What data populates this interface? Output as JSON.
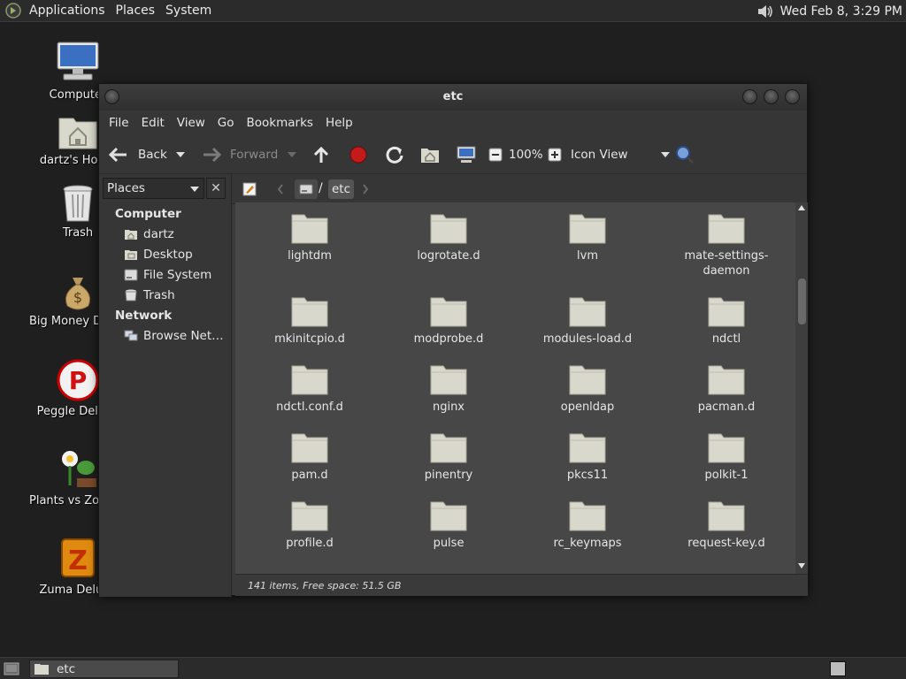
{
  "top_panel": {
    "menus": [
      "Applications",
      "Places",
      "System"
    ],
    "clock": "Wed Feb  8,  3:29 PM"
  },
  "desktop": {
    "icons": [
      {
        "label": "Computer",
        "icon": "computer-icon"
      },
      {
        "label": "dartz's Home",
        "icon": "home-folder-icon"
      },
      {
        "label": "Trash",
        "icon": "trash-icon"
      },
      {
        "label": "Big Money Deluxe",
        "icon": "money-bag-icon"
      },
      {
        "label": "Peggle Deluxe",
        "icon": "peggle-icon"
      },
      {
        "label": "Plants vs Zombies",
        "icon": "plants-icon"
      },
      {
        "label": "Zuma Deluxe",
        "icon": "zuma-icon"
      }
    ]
  },
  "window": {
    "title": "etc",
    "menu": [
      "File",
      "Edit",
      "View",
      "Go",
      "Bookmarks",
      "Help"
    ],
    "toolbar": {
      "back": "Back",
      "forward": "Forward",
      "zoom": "100%",
      "view_mode": "Icon View"
    },
    "location": {
      "separator": "/",
      "current": "etc"
    },
    "sidebar": {
      "selector": "Places",
      "close": "✕",
      "sections": [
        {
          "heading": "Computer",
          "items": [
            "dartz",
            "Desktop",
            "File System",
            "Trash"
          ]
        },
        {
          "heading": "Network",
          "items": [
            "Browse Net…"
          ]
        }
      ]
    },
    "files": [
      "lightdm",
      "logrotate.d",
      "lvm",
      "mate-settings-daemon",
      "mkinitcpio.d",
      "modprobe.d",
      "modules-load.d",
      "ndctl",
      "ndctl.conf.d",
      "nginx",
      "openldap",
      "pacman.d",
      "pam.d",
      "pinentry",
      "pkcs11",
      "polkit-1",
      "profile.d",
      "pulse",
      "rc_keymaps",
      "request-key.d"
    ],
    "status": "141 items, Free space: 51.5 GB"
  },
  "taskbar": {
    "tasks": [
      "etc"
    ]
  },
  "colors": {
    "folder": "#d9d8cc",
    "accent": "#f0f0f0"
  }
}
